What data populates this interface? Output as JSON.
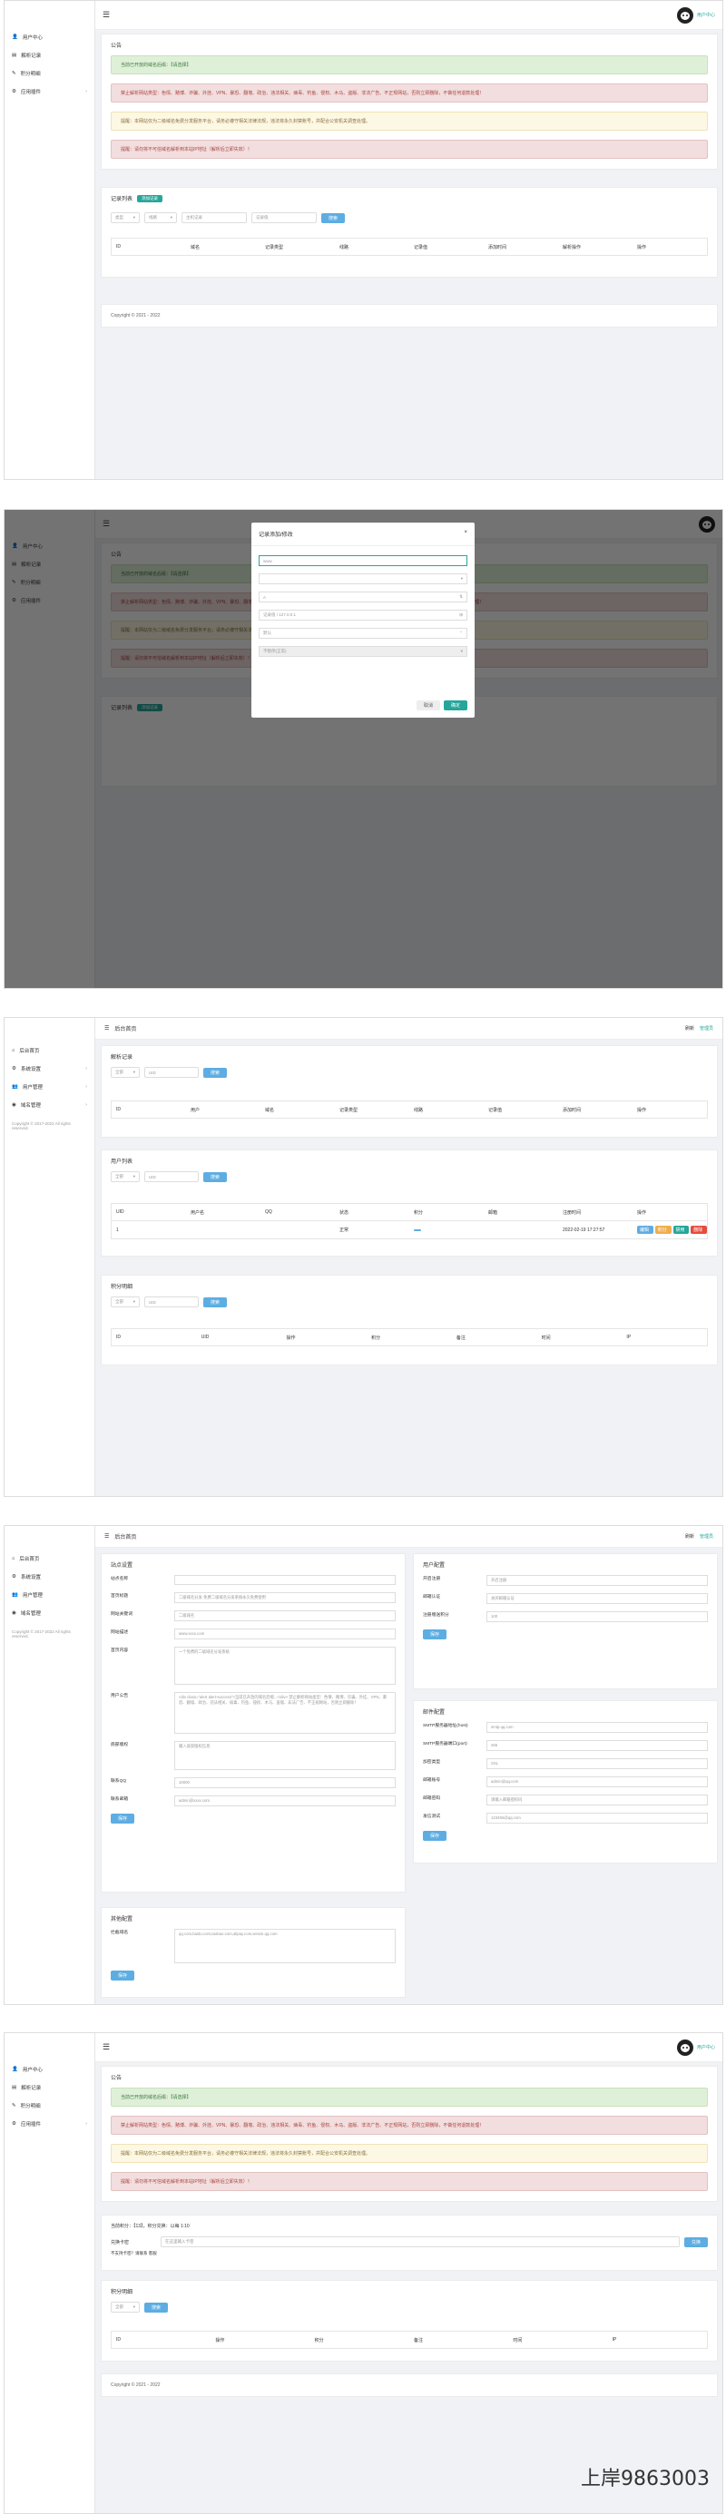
{
  "common": {
    "menu": [
      {
        "icon": "user-icon",
        "label": "用户中心"
      },
      {
        "icon": "record-icon",
        "label": "解析记录"
      },
      {
        "icon": "edit-icon",
        "label": "积分明细"
      },
      {
        "icon": "apps-icon",
        "label": "应用插件"
      }
    ],
    "notice_title": "公告",
    "alerts": [
      {
        "type": "green",
        "text": "当前已开放的域名后缀：【请选择】"
      },
      {
        "type": "red",
        "text": "禁止解析网站类型：色情、赌博、诈骗、外挂、VPN、暴恐、翻墙、政治、违法相关、病毒、钓鱼、侵权、木马、盗版、非法广告、不正规网站，否则立即删除，不做任何退款处理！"
      },
      {
        "type": "yellow",
        "text": "提醒：本网站仅为二级域名免费分发服务平台，请务必遵守相关法律法规，违法将永久封禁账号，并配合公安机关调查处理。"
      },
      {
        "type": "red",
        "text": "提醒：请勿将不可信域名解析到本站IP地址（解析后立即失效）！"
      }
    ],
    "records_title": "记录列表",
    "add_button": "添加记录",
    "filter": {
      "type_sel": "类型",
      "line_sel": "线路",
      "host_ph": "主机记录",
      "value_ph": "记录值",
      "search": "搜索"
    },
    "columns": [
      "ID",
      "域名",
      "记录类型",
      "线路",
      "记录值",
      "添加时间",
      "解析操作",
      "操作"
    ],
    "copyright": "Copyright © 2021 - 2022",
    "user_link": "用户中心"
  },
  "modal": {
    "title": "记录添加/修改",
    "fields": [
      {
        "ph": "www",
        "icon": ""
      },
      {
        "ph": "",
        "icon": "chevron-down"
      },
      {
        "ph": "A",
        "icon": "chevron-down"
      },
      {
        "ph": "记录值 / 127.0.0.1",
        "icon": "grid"
      },
      {
        "ph": "默认",
        "icon": "chevron-down"
      },
      {
        "ph": "不暂停(正常)",
        "icon": "chevron-down"
      }
    ],
    "cancel": "取消",
    "confirm": "确定"
  },
  "admin": {
    "brand": "后台首页",
    "menu": [
      {
        "icon": "home-icon",
        "label": "后台首页"
      },
      {
        "icon": "gear-icon",
        "label": "系统设置"
      },
      {
        "icon": "users-icon",
        "label": "用户管理"
      },
      {
        "icon": "domain-icon",
        "label": "域名管理"
      }
    ],
    "copyright": "Copyright © 2017-2022 All rights reserved.",
    "top_right": [
      "刷新",
      "管理员"
    ],
    "parse_title": "解析记录",
    "parse_cols": [
      "ID",
      "用户",
      "域名",
      "记录类型",
      "线路",
      "记录值",
      "添加时间",
      "操作"
    ],
    "user_title": "用户列表",
    "user_cols": [
      "UID",
      "用户名",
      "QQ",
      "状态",
      "积分",
      "邮箱",
      "注册时间",
      "操作"
    ],
    "user_row": [
      "1",
      "",
      "",
      "正常",
      "",
      "",
      "2022-02-19 17:27:57"
    ],
    "user_actions": [
      "编辑",
      "积分",
      "禁用",
      "删除"
    ],
    "points_title": "积分明细",
    "points_cols": [
      "ID",
      "UID",
      "操作",
      "积分",
      "备注",
      "时间",
      "IP"
    ],
    "search_sel": "全部",
    "search_ph": "UID",
    "search_btn": "搜索"
  },
  "settings": {
    "site_title": "站点设置",
    "site_fields": [
      {
        "label": "站点名称",
        "value": ""
      },
      {
        "label": "首页标题",
        "value": "二级域名分发·免费二级域名分发系统永久免费使用"
      },
      {
        "label": "网站关键词",
        "value": "二级域名"
      },
      {
        "label": "网站描述",
        "value": "www.xxxx.com"
      },
      {
        "label": "首页内容",
        "value": "一个免费的二级域名分发系统"
      },
      {
        "label": "用户公告",
        "value": "<div class=\"alert alert-success\">当前已开放的域名后缀...</div> 禁止解析网站类型：色情、赌博、诈骗、外挂、VPN、暴恐、翻墙、政治、违法相关、病毒、钓鱼、侵权、木马、盗版、非法广告、不正规网站，否则立即删除！"
      },
      {
        "label": "底部版权",
        "value": "输入底部版权信息"
      },
      {
        "label": "联系QQ",
        "value": "10000"
      },
      {
        "label": "联系邮箱",
        "value": "admin@xxxx.com"
      }
    ],
    "user_cfg_title": "用户配置",
    "user_cfg": [
      {
        "label": "开启注册",
        "value": "开启注册"
      },
      {
        "label": "邮箱认证",
        "value": "关闭邮箱认证"
      },
      {
        "label": "注册赠送积分",
        "value": "100"
      }
    ],
    "mail_title": "邮件配置",
    "mail_fields": [
      {
        "label": "SMTP服务器地址(host)",
        "value": "smtp.qq.com"
      },
      {
        "label": "SMTP服务器端口(port)",
        "value": "465"
      },
      {
        "label": "加密类型",
        "value": "SSL"
      },
      {
        "label": "邮箱账号",
        "value": "admin@qq.com"
      },
      {
        "label": "邮箱密码",
        "value": "请输入邮箱授权码"
      },
      {
        "label": "发信测试",
        "value": "123456@qq.com"
      }
    ],
    "other_title": "其他配置",
    "other_field": {
      "label": "拦截域名",
      "value": "qq.com,baidu.com,taobao.com,alipay.com,weixin.qq.com"
    },
    "save": "保存"
  },
  "points_page": {
    "info": "当前积分：【13】，积分兑换：以每 1:10",
    "code_label": "兑换卡密",
    "code_ph": "在这里输入卡密",
    "code_btn": "兑换",
    "hint": "不支持卡密？请联系 客服",
    "list_title": "积分明细",
    "cols": [
      "ID",
      "操作",
      "积分",
      "备注",
      "时间",
      "IP"
    ]
  },
  "watermark": "上岸9863003"
}
